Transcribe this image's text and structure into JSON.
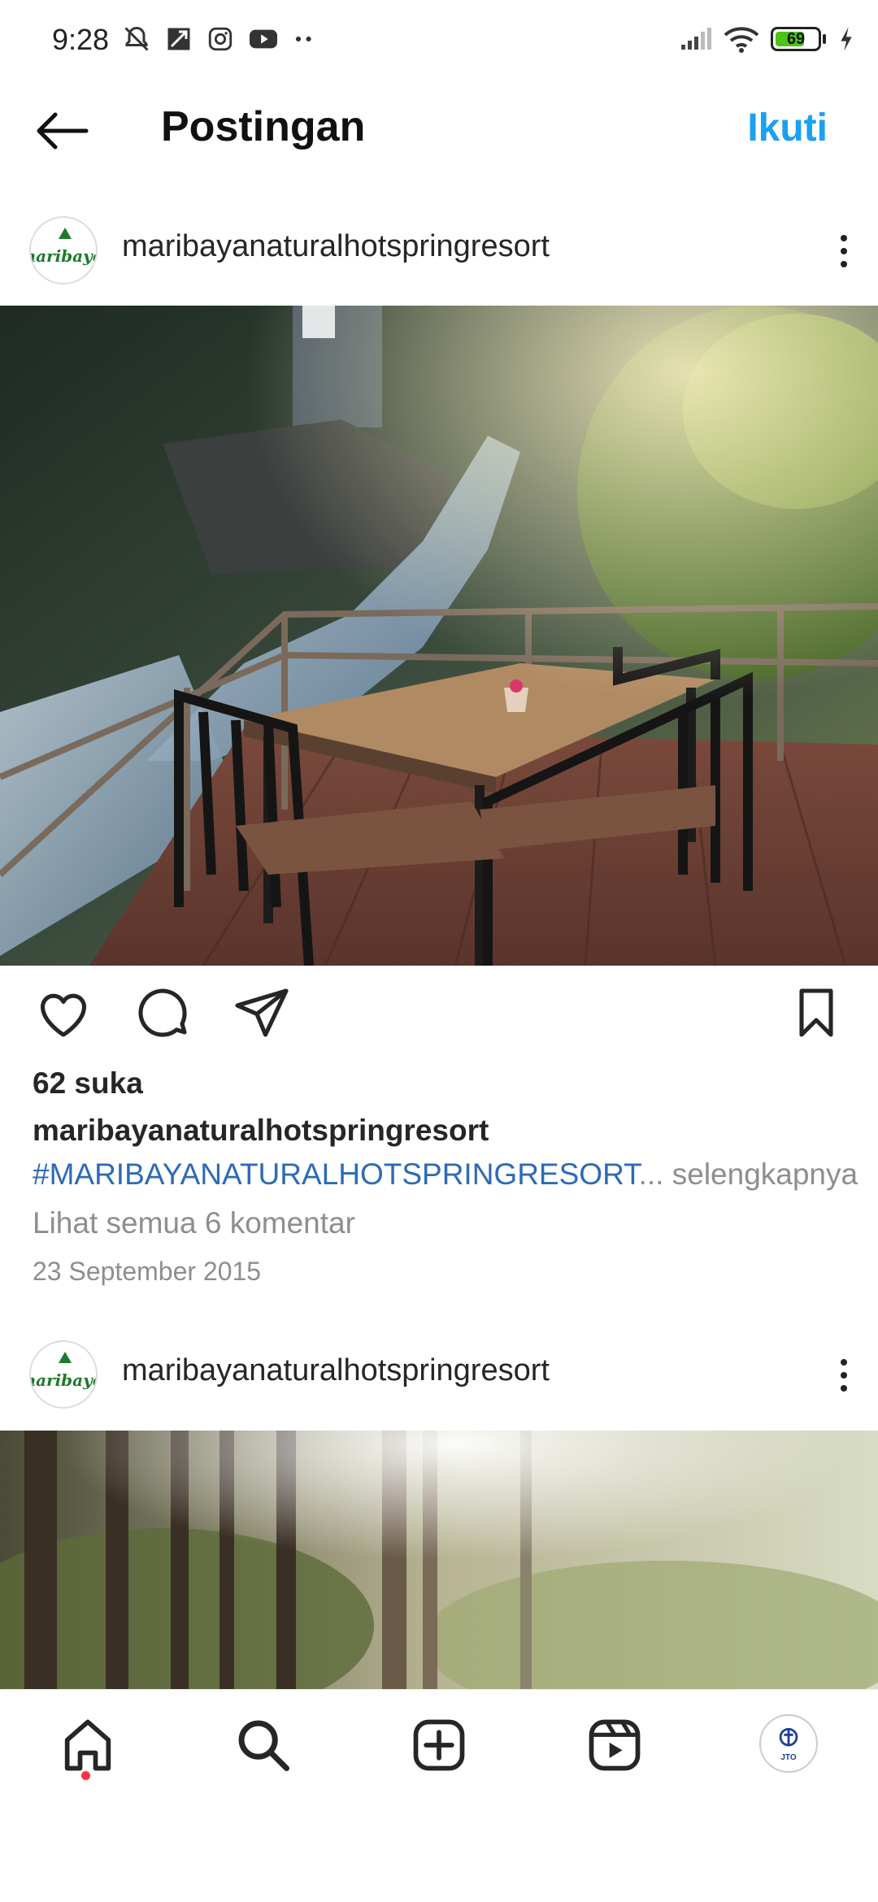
{
  "status_bar": {
    "time": "9:28",
    "battery": "69",
    "battery_level": 0.69,
    "icons_left": [
      "notifications-muted-icon",
      "maps-icon",
      "instagram-icon",
      "youtube-icon",
      "more-dots-icon"
    ],
    "icons_right": [
      "signal-icon",
      "wifi-icon",
      "battery-icon",
      "charging-icon"
    ]
  },
  "header": {
    "title": "Postingan",
    "follow_label": "Ikuti"
  },
  "posts": [
    {
      "username": "maribayanaturalhotspringresort",
      "avatar_text": "naribaye",
      "likes": "62 suka",
      "caption_user": "maribayanaturalhotspringresort",
      "caption_hashtag": "#MARIBAYANATURALHOTSPRINGRESORT",
      "caption_ellipsis": "...",
      "more_label": "selengkapnya",
      "comments_label": "Lihat semua 6 komentar",
      "date": "23 September 2015"
    },
    {
      "username": "maribayanaturalhotspringresort",
      "avatar_text": "naribaye"
    }
  ],
  "bottom_nav": {
    "items": [
      "home-icon",
      "search-icon",
      "create-icon",
      "reels-icon",
      "profile-avatar"
    ],
    "profile_text": "JTO",
    "accent": "#ff3040"
  },
  "colors": {
    "follow": "#1ba0f2",
    "hashtag": "#2d6bb5",
    "muted": "#8e8e8e"
  }
}
